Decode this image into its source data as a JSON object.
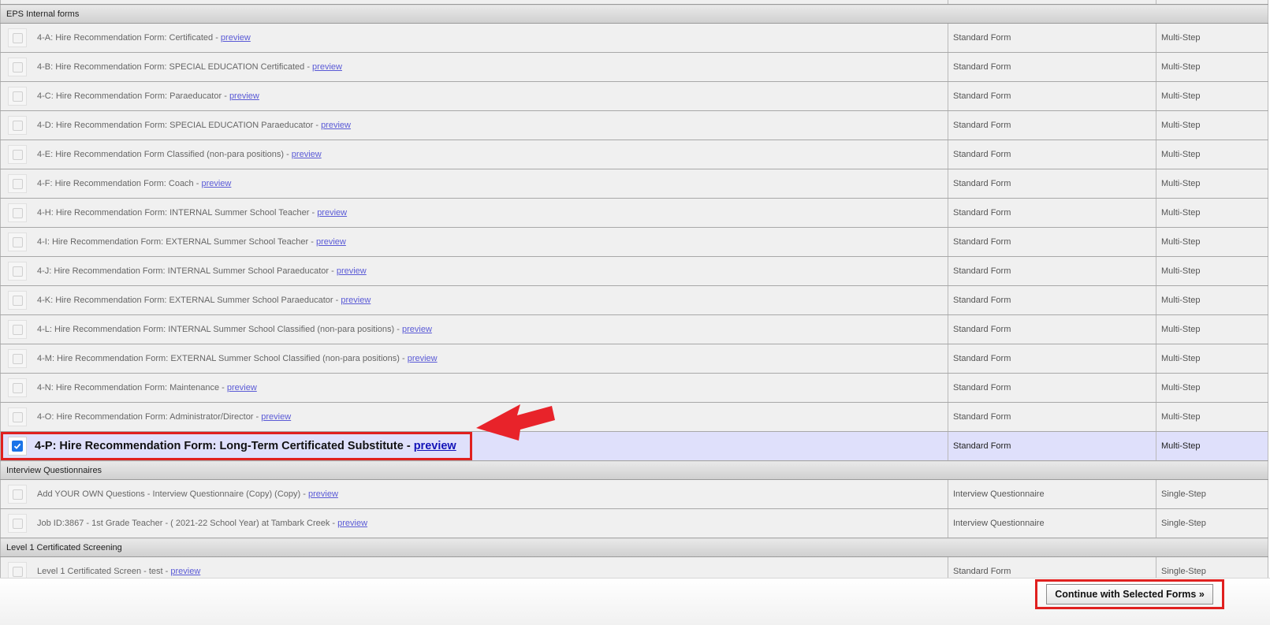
{
  "groups": [
    {
      "title": "EPS Internal forms",
      "rows": [
        {
          "name": "4-A: Hire Recommendation Form: Certificated",
          "preview": "preview",
          "type": "Standard Form",
          "steps": "Multi-Step",
          "checked": false
        },
        {
          "name": "4-B: Hire Recommendation Form: SPECIAL EDUCATION Certificated",
          "preview": "preview",
          "type": "Standard Form",
          "steps": "Multi-Step",
          "checked": false
        },
        {
          "name": "4-C: Hire Recommendation Form: Paraeducator",
          "preview": "preview",
          "type": "Standard Form",
          "steps": "Multi-Step",
          "checked": false
        },
        {
          "name": "4-D: Hire Recommendation Form: SPECIAL EDUCATION Paraeducator",
          "preview": "preview",
          "type": "Standard Form",
          "steps": "Multi-Step",
          "checked": false
        },
        {
          "name": "4-E: Hire Recommendation Form Classified (non-para positions)",
          "preview": "preview",
          "type": "Standard Form",
          "steps": "Multi-Step",
          "checked": false
        },
        {
          "name": "4-F: Hire Recommendation Form: Coach",
          "preview": "preview",
          "type": "Standard Form",
          "steps": "Multi-Step",
          "checked": false
        },
        {
          "name": "4-H: Hire Recommendation Form: INTERNAL Summer School Teacher",
          "preview": "preview",
          "type": "Standard Form",
          "steps": "Multi-Step",
          "checked": false
        },
        {
          "name": "4-I: Hire Recommendation Form: EXTERNAL Summer School Teacher",
          "preview": "preview",
          "type": "Standard Form",
          "steps": "Multi-Step",
          "checked": false
        },
        {
          "name": "4-J: Hire Recommendation Form: INTERNAL Summer School Paraeducator",
          "preview": "preview",
          "type": "Standard Form",
          "steps": "Multi-Step",
          "checked": false
        },
        {
          "name": "4-K: Hire Recommendation Form: EXTERNAL Summer School Paraeducator",
          "preview": "preview",
          "type": "Standard Form",
          "steps": "Multi-Step",
          "checked": false
        },
        {
          "name": "4-L: Hire Recommendation Form: INTERNAL Summer School Classified (non-para positions)",
          "preview": "preview",
          "type": "Standard Form",
          "steps": "Multi-Step",
          "checked": false
        },
        {
          "name": "4-M: Hire Recommendation Form: EXTERNAL Summer School Classified (non-para positions)",
          "preview": "preview",
          "type": "Standard Form",
          "steps": "Multi-Step",
          "checked": false
        },
        {
          "name": "4-N: Hire Recommendation Form: Maintenance",
          "preview": "preview",
          "type": "Standard Form",
          "steps": "Multi-Step",
          "checked": false
        },
        {
          "name": "4-O: Hire Recommendation Form: Administrator/Director",
          "preview": "preview",
          "type": "Standard Form",
          "steps": "Multi-Step",
          "checked": false
        },
        {
          "name": "4-P: Hire Recommendation Form: Long-Term Certificated Substitute",
          "preview": "preview",
          "type": "Standard Form",
          "steps": "Multi-Step",
          "checked": true
        }
      ]
    },
    {
      "title": "Interview Questionnaires",
      "rows": [
        {
          "name": "Add YOUR OWN Questions - Interview Questionnaire (Copy) (Copy)",
          "preview": "preview",
          "type": "Interview Questionnaire",
          "steps": "Single-Step",
          "checked": false
        },
        {
          "name": "Job ID:3867 - 1st Grade Teacher - ( 2021-22 School Year) at Tambark Creek",
          "preview": "preview",
          "type": "Interview Questionnaire",
          "steps": "Single-Step",
          "checked": false
        }
      ]
    },
    {
      "title": "Level 1 Certificated Screening",
      "rows": [
        {
          "name": "Level 1 Certificated Screen - test",
          "preview": "preview",
          "type": "Standard Form",
          "steps": "Single-Step",
          "checked": false
        }
      ]
    }
  ],
  "separator": " - ",
  "footer": {
    "continue_label": "Continue with Selected Forms »"
  },
  "colors": {
    "highlight": "#e0201f",
    "selected_row": "#dfe0fb",
    "checkbox_checked": "#1a73e8",
    "link": "#5a5ad6"
  },
  "icons": {
    "annotation": "red-arrow-icon",
    "check": "checkmark-icon"
  }
}
